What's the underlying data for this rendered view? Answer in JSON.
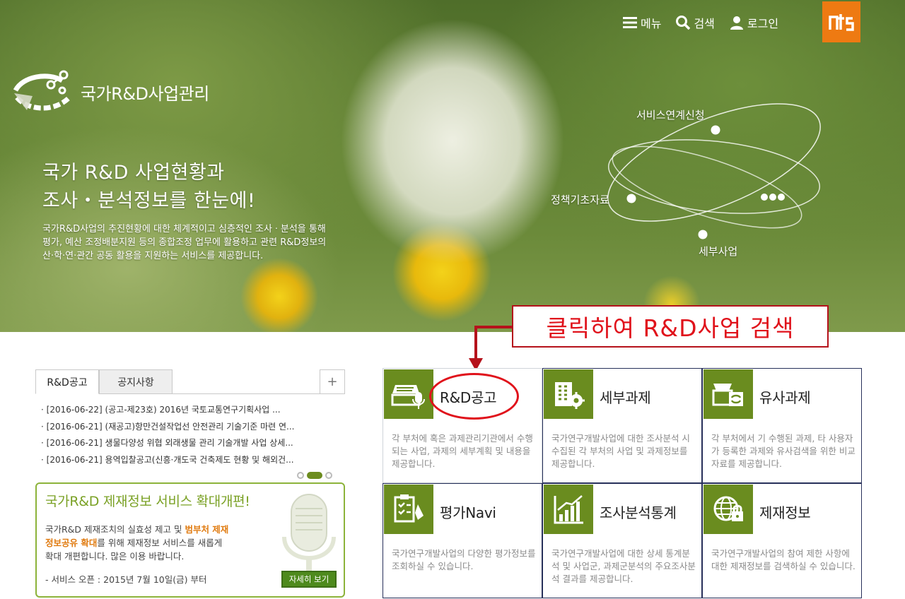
{
  "header": {
    "nav": [
      {
        "label": "메뉴",
        "icon": "hamburger-menu-icon"
      },
      {
        "label": "검색",
        "icon": "search-icon"
      },
      {
        "label": "로그인",
        "icon": "user-icon"
      }
    ],
    "logo_icon": "nts-logo-icon",
    "logo_color": "#ee7a12"
  },
  "brand": {
    "title": "국가R&D사업관리",
    "icon": "rnd-brand-logo-icon"
  },
  "hero": {
    "headline_1": "국가 R&D 사업현황과",
    "headline_2": "조사・분석정보를 한눈에!",
    "desc_1": "국가R&D사업의 추진현황에 대한 체계적이고 심층적인 조사ㆍ분석을 통해",
    "desc_2": "평가, 예산 조정배분지원 등의 종합조정 업무에 활용하고 관련 R&D정보의",
    "desc_3": "산·학·연·관간 공동 활용을 지원하는 서비스를 제공합니다.",
    "orbit": {
      "service_link": "서비스연계신청",
      "policy_data": "정책기초자료",
      "detail_project": "세부사업"
    }
  },
  "annotation": {
    "callout_text": "클릭하여 R&D사업 검색",
    "accent_color": "#e0121b"
  },
  "notices": {
    "tabs": [
      "R&D공고",
      "공지사항"
    ],
    "more_label": "+",
    "items": [
      "[2016-06-22] (공고-제23호) 2016년 국토교통연구기획사업 ...",
      "[2016-06-21] (재공고)항만건설작업선 안전관리 기술기준 마련 연...",
      "[2016-06-21] 생물다양성 위협 외래생물 관리 기술개발 사업 상세...",
      "[2016-06-21] 용역입찰공고(신흥·개도국 건축제도 현황 및 해외건..."
    ]
  },
  "banner": {
    "title": "국가R&D 제재정보 서비스 확대개편!",
    "text_1": "국가R&D 제재조치의 실효성 제고 및 ",
    "text_hl_1": "범부처 제재",
    "text_hl_2": "정보공유 확대",
    "text_2": "를 위해 제재정보 서비스를 새롭게",
    "text_3": "확대 개편합니다.  많은 이용 바랍니다.",
    "opening": "- 서비스 오픈 : 2015년 7월 10일(금) 부터",
    "button": "자세히 보기",
    "accent_color": "#8cb33a",
    "highlight_color": "#e07b10"
  },
  "services": [
    {
      "title": "R&D공고",
      "icon": "announcement-tray-icon",
      "desc": "각 부처에 혹은 과제관리기관에서 수행되는 사업, 과제의 세부계획 및 내용을 제공합니다."
    },
    {
      "title": "세부과제",
      "icon": "building-gear-icon",
      "desc": "국가연구개발사업에 대한 조사분석 시 수집된 각 부처의 사업 및 과제정보를 제공합니다."
    },
    {
      "title": "유사과제",
      "icon": "document-compare-icon",
      "desc": "각 부처에서 기 수행된 과제, 타 사용자가 등록한 과제와 유사검색을 위한 비교자료를 제공합니다."
    },
    {
      "title": "평가Navi",
      "icon": "clipboard-evaluation-icon",
      "desc": "국가연구개발사업의 다양한 평가정보를 조회하실 수 있습니다."
    },
    {
      "title": "조사분석통계",
      "icon": "bar-chart-icon",
      "desc": "국가연구개발사업에 대한 상세 통계분석 및 사업군, 과제군분석의 주요조사분석 결과를 제공합니다."
    },
    {
      "title": "제재정보",
      "icon": "globe-lock-icon",
      "desc": "국가연구개발사업의 참여 제한 사항에 대한 제재정보를 검색하실 수 있습니다."
    }
  ],
  "colors": {
    "service_icon_bg": "#6a8c1f"
  }
}
